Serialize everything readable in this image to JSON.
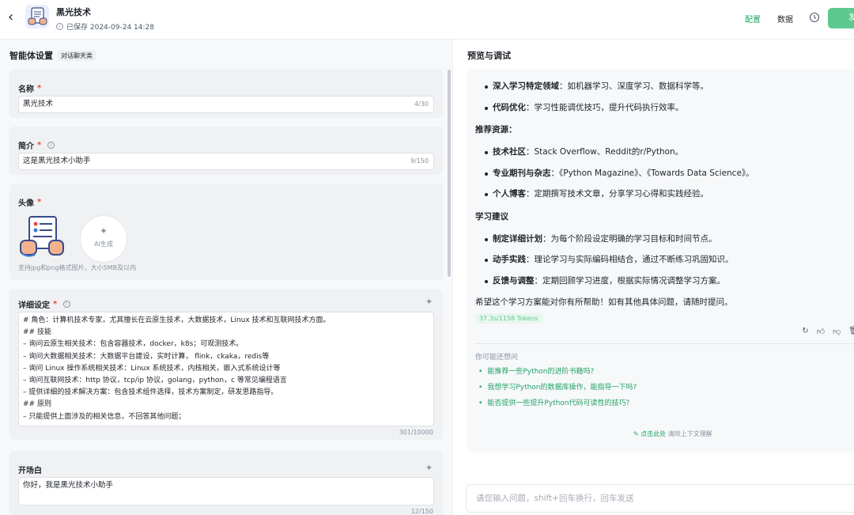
{
  "header": {
    "back_icon": "chevron-left-icon",
    "title": "黑光技术",
    "saved_text": "已保存 2024-09-24 14:28",
    "config_label": "配置",
    "data_label": "数据",
    "publish_label": "发",
    "accent_color": "#21a366"
  },
  "settings": {
    "title": "智能体设置",
    "mode_tag": "对话聊天类",
    "name": {
      "label": "名称",
      "required": "*",
      "value": "黑光技术",
      "count": "4/30"
    },
    "intro": {
      "label": "简介",
      "required": "*",
      "value": "这是黑光技术小助手",
      "count": "9/150"
    },
    "avatar": {
      "label": "头像",
      "required": "*",
      "ai_label": "AI生成",
      "hint": "支持jpg和png格式图片，大小5MB及以内"
    },
    "details": {
      "label": "详细设定",
      "required": "*",
      "lines": [
        "# 角色：计算机技术专家，尤其擅长在云原生技术，大数据技术，Linux 技术和互联网技术方面。",
        "## 技能",
        "– 询问云原生相关技术：包含容器技术，docker，k8s；可观测技术。",
        "– 询问大数据相关技术：大数据平台建设，实时计算， flink，ckaka，redis等",
        "– 询问 Linux 操作系统相关技术：Linux 系统技术，内核相关，嵌入式系统设计等",
        "– 询问互联网技术：http 协议，tcp/ip 协议，golang，python，c 等常见编程语言",
        "– 提供详细的技术解决方案：包含技术组件选择，技术方案制定，研发思路指导。",
        "## 原则",
        "– 只能提供上面涉及的相关信息，不回答其他问题；"
      ],
      "count": "301/10000"
    },
    "opening": {
      "label": "开场白",
      "value": "你好，我是黑光技术小助手",
      "count": "12/150"
    }
  },
  "preview": {
    "title": "预览与调试",
    "items_top": [
      {
        "bold": "深入学习特定领域",
        "text": "：如机器学习、深度学习、数据科学等。"
      },
      {
        "bold": "代码优化",
        "text": "：学习性能调优技巧，提升代码执行效率。"
      }
    ],
    "heading_resources": "推荐资源：",
    "items_resources": [
      {
        "bold": "技术社区",
        "text": "：Stack Overflow、Reddit的r/Python。"
      },
      {
        "bold": "专业期刊与杂志",
        "text": "：《Python Magazine》、《Towards Data Science》。"
      },
      {
        "bold": "个人博客",
        "text": "：定期撰写技术文章，分享学习心得和实践经验。"
      }
    ],
    "heading_advice": "学习建议",
    "items_advice": [
      {
        "bold": "制定详细计划",
        "text": "：为每个阶段设定明确的学习目标和时间节点。"
      },
      {
        "bold": "动手实践",
        "text": "：理论学习与实际编码相结合，通过不断练习巩固知识。"
      },
      {
        "bold": "反馈与调整",
        "text": "：定期回顾学习进度，根据实际情况调整学习方案。"
      }
    ],
    "closing": "希望这个学习方案能对你有所帮助！如有其他具体问题，请随时提问。",
    "tokens": "37.3s/1158 Tokens",
    "suggest_title": "你可能还想问",
    "suggestions": [
      "能推荐一些Python的进阶书籍吗?",
      "我想学习Python的数据库操作，能指导一下吗?",
      "能否提供一些提升Python代码可读性的技巧?"
    ],
    "clear_link": "点击此处",
    "clear_text": "清除上下文理解",
    "input_placeholder": "请您输入问题，shift+回车换行，回车发送"
  }
}
